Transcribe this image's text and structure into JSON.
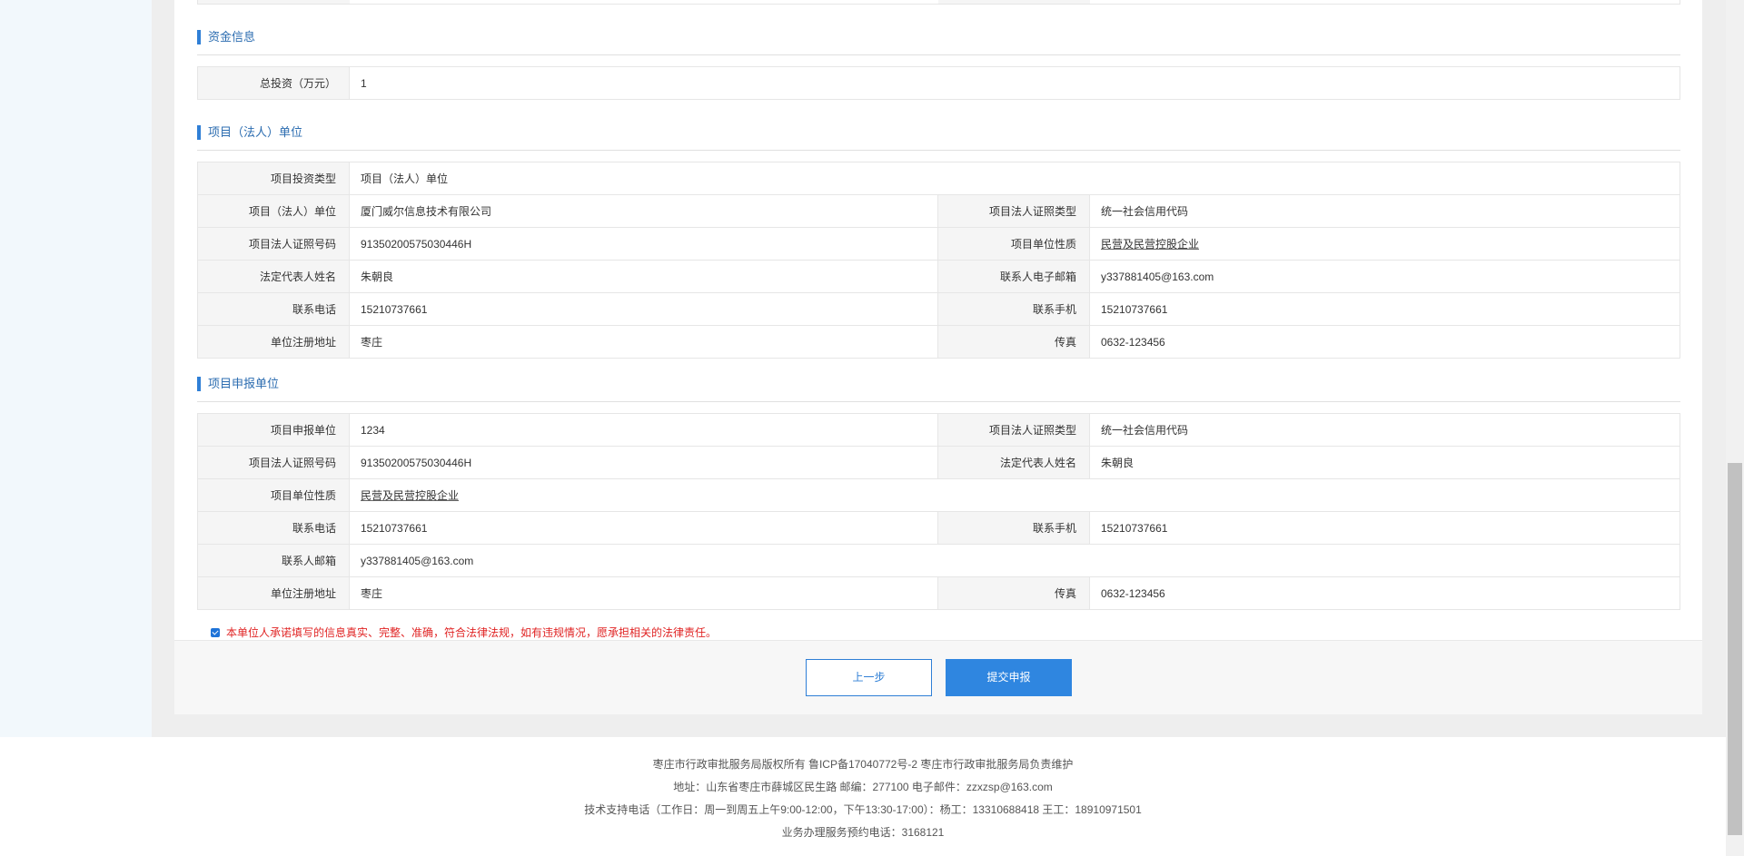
{
  "funding": {
    "title": "资金信息",
    "total_investment_label": "总投资（万元）",
    "total_investment_value": "1"
  },
  "legal_unit": {
    "title": "项目（法人）单位",
    "investment_type_label": "项目投资类型",
    "investment_type_value": "项目（法人）单位",
    "unit_label": "项目（法人）单位",
    "unit_value": "厦门威尔信息技术有限公司",
    "license_type_label": "项目法人证照类型",
    "license_type_value": "统一社会信用代码",
    "license_no_label": "项目法人证照号码",
    "license_no_value": "91350200575030446H",
    "nature_label": "项目单位性质",
    "nature_value": "民营及民营控股企业",
    "rep_label": "法定代表人姓名",
    "rep_value": "朱朝良",
    "email_label": "联系人电子邮箱",
    "email_value": "y337881405@163.com",
    "phone_label": "联系电话",
    "phone_value": "15210737661",
    "mobile_label": "联系手机",
    "mobile_value": "15210737661",
    "address_label": "单位注册地址",
    "address_value": "枣庄",
    "fax_label": "传真",
    "fax_value": "0632-123456"
  },
  "declare_unit": {
    "title": "项目申报单位",
    "unit_label": "项目申报单位",
    "unit_value": "1234",
    "license_type_label": "项目法人证照类型",
    "license_type_value": "统一社会信用代码",
    "license_no_label": "项目法人证照号码",
    "license_no_value": "91350200575030446H",
    "rep_label": "法定代表人姓名",
    "rep_value": "朱朝良",
    "nature_label": "项目单位性质",
    "nature_value": "民营及民营控股企业",
    "phone_label": "联系电话",
    "phone_value": "15210737661",
    "mobile_label": "联系手机",
    "mobile_value": "15210737661",
    "email_label": "联系人邮箱",
    "email_value": "y337881405@163.com",
    "address_label": "单位注册地址",
    "address_value": "枣庄",
    "fax_label": "传真",
    "fax_value": "0632-123456"
  },
  "commitment": {
    "checked": true,
    "text": "本单位人承诺填写的信息真实、完整、准确，符合法律法规，如有违规情况，愿承担相关的法律责任。"
  },
  "buttons": {
    "prev": "上一步",
    "submit": "提交申报"
  },
  "footer": {
    "line1": "枣庄市行政审批服务局版权所有  鲁ICP备17040772号-2  枣庄市行政审批服务局负责维护",
    "line2": "地址：山东省枣庄市薛城区民生路 邮编：277100 电子邮件：zzxzsp@163.com",
    "line3": "技术支持电话（工作日：周一到周五上午9:00-12:00，下午13:30-17:00）：杨工：13310688418  王工：18910971501",
    "line4": "业务办理服务预约电话：3168121"
  },
  "colors": {
    "accent": "#2f86e0",
    "warning_text": "#e02424"
  }
}
